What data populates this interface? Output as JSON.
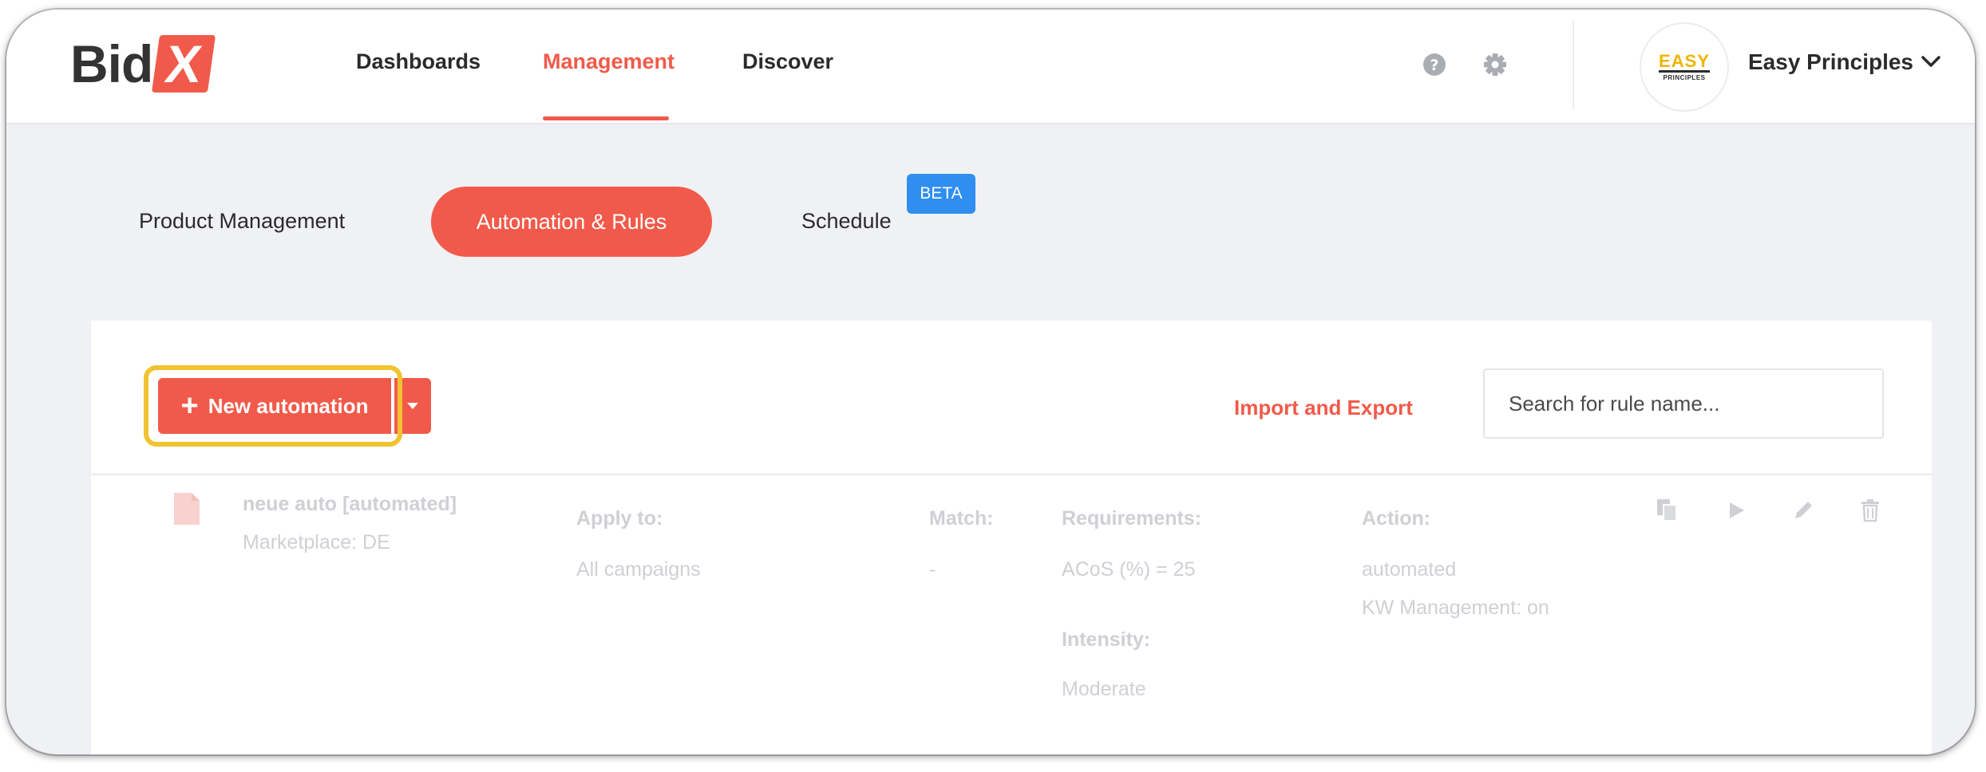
{
  "app": {
    "logo_main": "Bid",
    "logo_accent": "X",
    "accent_color": "#f15a4a"
  },
  "header": {
    "nav": [
      {
        "label": "Dashboards",
        "active": false
      },
      {
        "label": "Management",
        "active": true
      },
      {
        "label": "Discover",
        "active": false
      }
    ],
    "icons": [
      "help-icon",
      "gear-icon"
    ],
    "account": {
      "avatar_top": "EASY",
      "avatar_bottom": "PRINCIPLES",
      "name": "Easy Principles"
    }
  },
  "subnav": {
    "items": [
      {
        "label": "Product Management",
        "active": false
      },
      {
        "label": "Automation & Rules",
        "active": true
      },
      {
        "label": "Schedule",
        "active": false,
        "badge": "BETA"
      }
    ]
  },
  "toolbar": {
    "new_button_label": "New automation",
    "import_export_label": "Import and Export",
    "search_placeholder": "Search for rule name..."
  },
  "rules": [
    {
      "name": "neue auto [automated]",
      "marketplace": "Marketplace: DE",
      "apply_to_label": "Apply to:",
      "apply_to": "All campaigns",
      "match_label": "Match:",
      "match": "-",
      "requirements_label": "Requirements:",
      "requirements": "ACoS (%) = 25",
      "intensity_label": "Intensity:",
      "intensity": "Moderate",
      "action_label": "Action:",
      "action": "automated",
      "action_detail": "KW Management: on"
    }
  ]
}
